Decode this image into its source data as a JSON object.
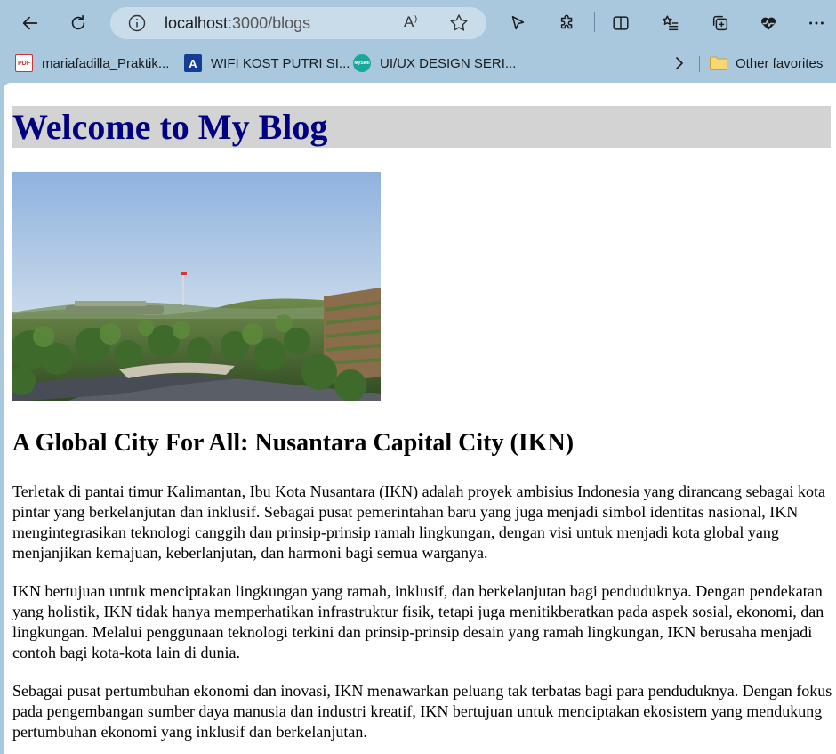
{
  "browser": {
    "address": {
      "host": "localhost",
      "path": ":3000/blogs"
    },
    "favorites": [
      {
        "label": "mariafadilla_Praktik...",
        "icon": "pdf-icon"
      },
      {
        "label": "WIFI KOST PUTRI SI...",
        "icon": "a-icon"
      },
      {
        "label": "UI/UX DESIGN SERI...",
        "icon": "myskill-icon"
      }
    ],
    "other_favorites": "Other favorites",
    "icons": {
      "back": "back-arrow-icon",
      "refresh": "refresh-icon",
      "info": "info-icon",
      "read_aloud": "read-aloud-icon",
      "favorite": "star-icon",
      "cursor": "cursor-icon",
      "extensions": "puzzle-icon",
      "split": "split-screen-icon",
      "favorites_list": "favorites-list-icon",
      "collections": "collections-icon",
      "health": "browser-essentials-icon",
      "more": "more-icon"
    },
    "favicon_text": {
      "pdf": "PDF",
      "a": "A",
      "myskill": "MySkill"
    },
    "read_aloud_glyph": "A⁾"
  },
  "page": {
    "title": "Welcome to My Blog",
    "post": {
      "title": "A Global City For All: Nusantara Capital City (IKN)",
      "paragraphs": [
        "Terletak di pantai timur Kalimantan, Ibu Kota Nusantara (IKN) adalah proyek ambisius Indonesia yang dirancang sebagai kota pintar yang berkelanjutan dan inklusif. Sebagai pusat pemerintahan baru yang juga menjadi simbol identitas nasional, IKN mengintegrasikan teknologi canggih dan prinsip-prinsip ramah lingkungan, dengan visi untuk menjadi kota global yang menjanjikan kemajuan, keberlanjutan, dan harmoni bagi semua warganya.",
        "IKN bertujuan untuk menciptakan lingkungan yang ramah, inklusif, dan berkelanjutan bagi penduduknya. Dengan pendekatan yang holistik, IKN tidak hanya memperhatikan infrastruktur fisik, tetapi juga menitikberatkan pada aspek sosial, ekonomi, dan lingkungan. Melalui penggunaan teknologi terkini dan prinsip-prinsip desain yang ramah lingkungan, IKN berusaha menjadi contoh bagi kota-kota lain di dunia.",
        "Sebagai pusat pertumbuhan ekonomi dan inovasi, IKN menawarkan peluang tak terbatas bagi para penduduknya. Dengan fokus pada pengembangan sumber daya manusia dan industri kreatif, IKN bertujuan untuk menciptakan ekosistem yang mendukung pertumbuhan ekonomi yang inklusif dan berkelanjutan."
      ]
    }
  },
  "colors": {
    "chrome": "#a9c8de",
    "address_bar": "#c9dcea",
    "title_bg": "#d3d3d3",
    "title_text": "#000080"
  }
}
